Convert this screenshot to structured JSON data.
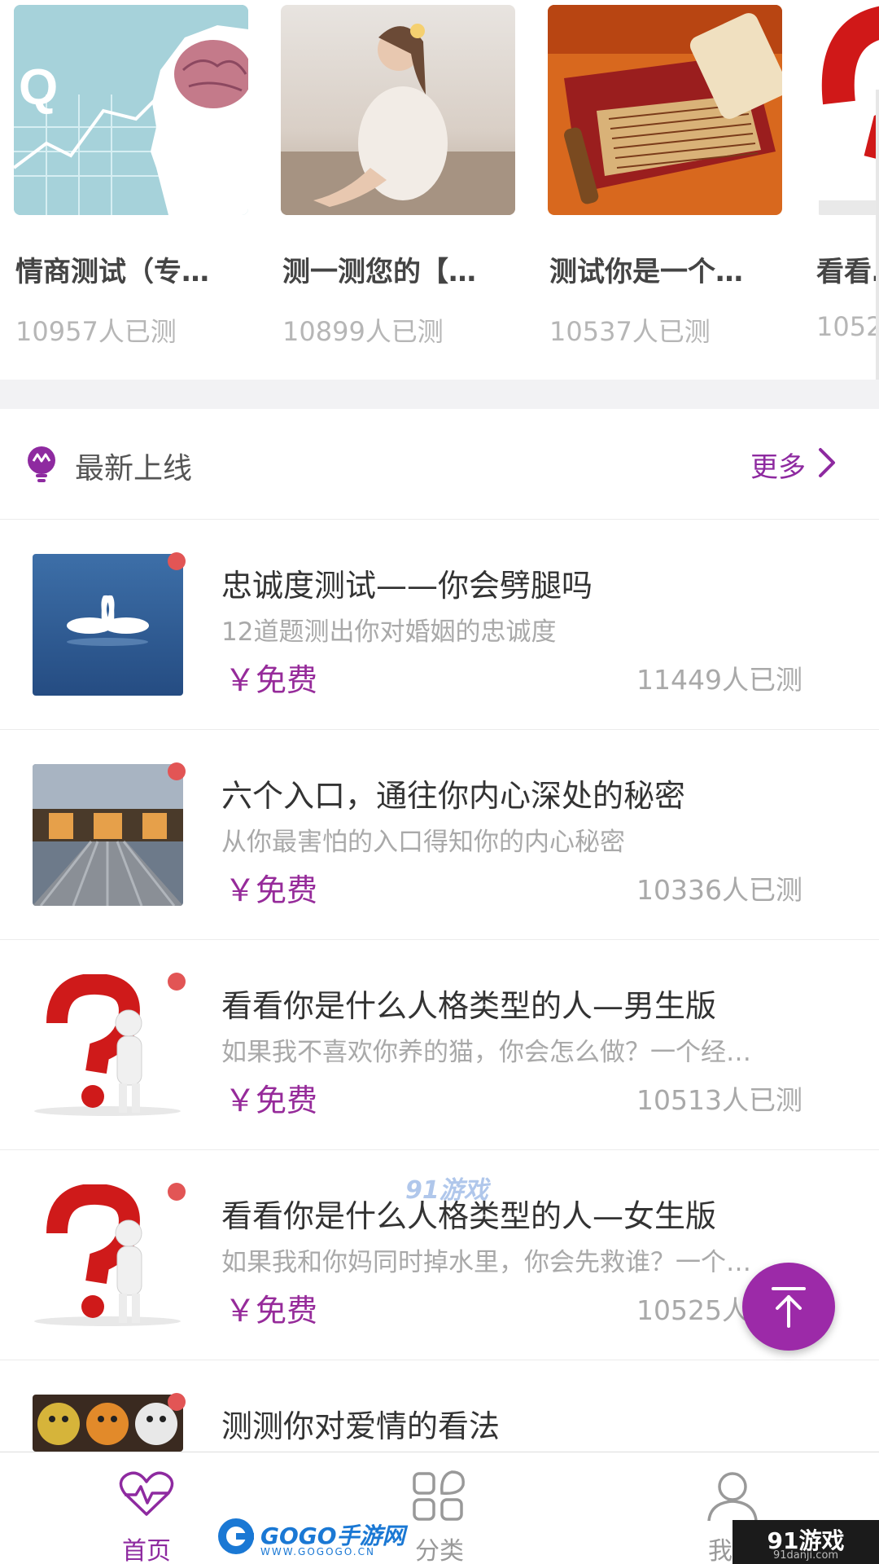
{
  "carousel": {
    "cards": [
      {
        "title": "情商测试（专…",
        "count": "10957人已测"
      },
      {
        "title": "测一测您的【…",
        "count": "10899人已测"
      },
      {
        "title": "测试你是一个…",
        "count": "10537人已测"
      },
      {
        "title": "看看…",
        "count": "1052…"
      }
    ]
  },
  "section": {
    "icon": "lightbulb-icon",
    "title": "最新上线",
    "more_label": "更多"
  },
  "list": [
    {
      "title": "忠诚度测试——你会劈腿吗",
      "desc": "12道题测出你对婚姻的忠诚度",
      "price": "￥免费",
      "count": "11449人已测"
    },
    {
      "title": "六个入口，通往你内心深处的秘密",
      "desc": "从你最害怕的入口得知你的内心秘密",
      "price": "￥免费",
      "count": "10336人已测"
    },
    {
      "title": "看看你是什么人格类型的人—男生版",
      "desc": "如果我不喜欢你养的猫，你会怎么做？一个经…",
      "price": "￥免费",
      "count": "10513人已测"
    },
    {
      "title": "看看你是什么人格类型的人—女生版",
      "desc": "如果我和你妈同时掉水里，你会先救谁？一个…",
      "price": "￥免费",
      "count": "10525人已测"
    },
    {
      "title": "测测你对爱情的看法"
    }
  ],
  "nav": {
    "home": "首页",
    "category": "分类",
    "mine": "我的"
  },
  "watermarks": {
    "gogo": "GOGO手游网",
    "gogo_sub": "WWW.GOGOGO.CN",
    "n91": "91游戏",
    "n91_sub": "91danji.com",
    "mid": "91游戏"
  },
  "colors": {
    "accent": "#962b9a",
    "fab": "#9c2aa8",
    "dot": "#e25555"
  }
}
